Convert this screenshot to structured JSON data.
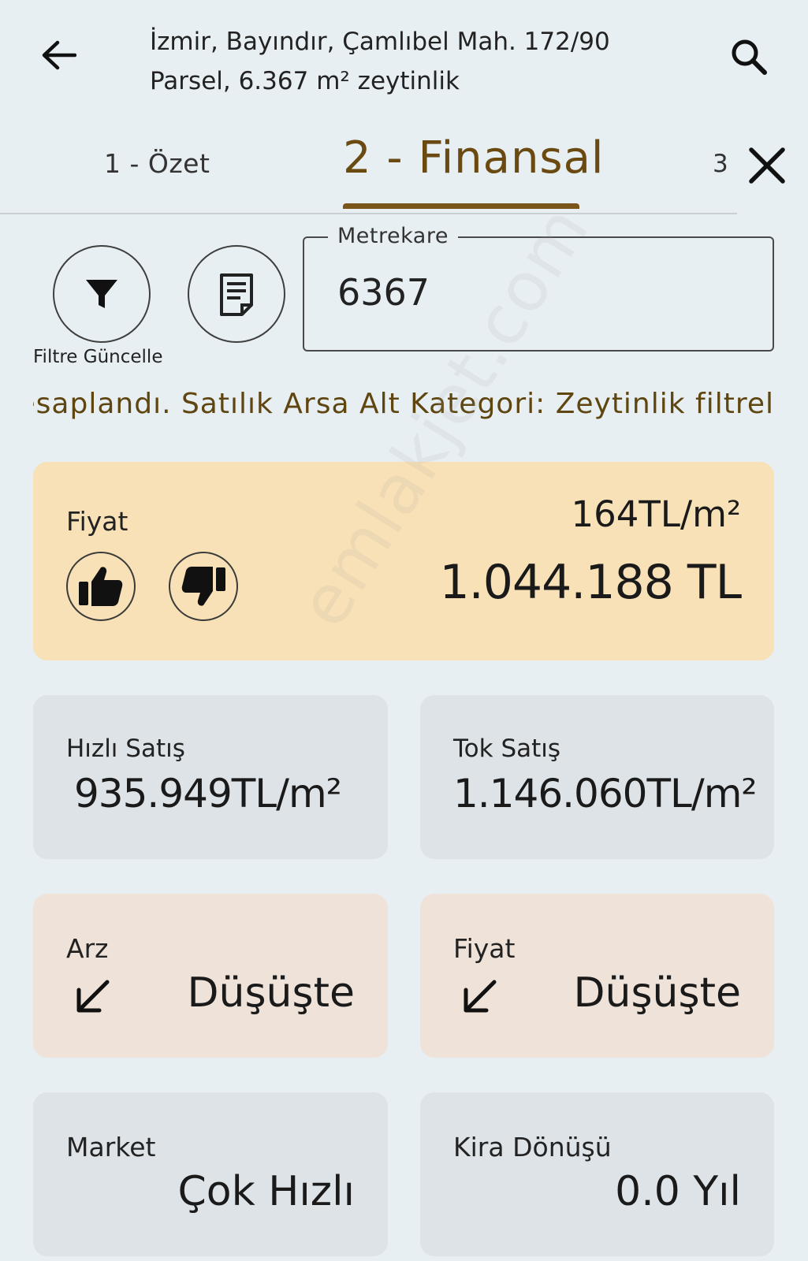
{
  "header": {
    "title_line1": "İzmir, Bayındır, Çamlıbel Mah. 172/90",
    "title_line2": "Parsel, 6.367 m² zeytinlik"
  },
  "tabs": [
    {
      "label": "1 - Özet"
    },
    {
      "label": "2 - Finansal",
      "active": true
    },
    {
      "label": "3"
    }
  ],
  "filter": {
    "label": "Filtre Güncelle"
  },
  "metrekare": {
    "label": "Metrekare",
    "value": "6367"
  },
  "marquee": "esaplandı. Satılık Arsa Alt Kategori: Zeytinlik filtrel",
  "price_card": {
    "label": "Fiyat",
    "per_m2": "164TL/m²",
    "total": "1.044.188 TL"
  },
  "quick_sale": {
    "label": "Hızlı Satış",
    "value": "935.949TL/m²"
  },
  "bulk_sale": {
    "label": "Tok Satış",
    "value": "1.146.060TL/m²"
  },
  "supply": {
    "label": "Arz",
    "value": "Düşüşte"
  },
  "price_trend": {
    "label": "Fiyat",
    "value": "Düşüşte"
  },
  "market": {
    "label": "Market",
    "value": "Çok Hızlı"
  },
  "rent_return": {
    "label": "Kira Dönüşü",
    "value": "0.0 Yıl"
  },
  "watermark": "emlakjet.com",
  "colors": {
    "background": "#e8eff3",
    "accent": "#7a5519",
    "price_card": "#f8e1b6",
    "grey_card": "#dde3e6",
    "peach_card": "#efe3d9"
  }
}
